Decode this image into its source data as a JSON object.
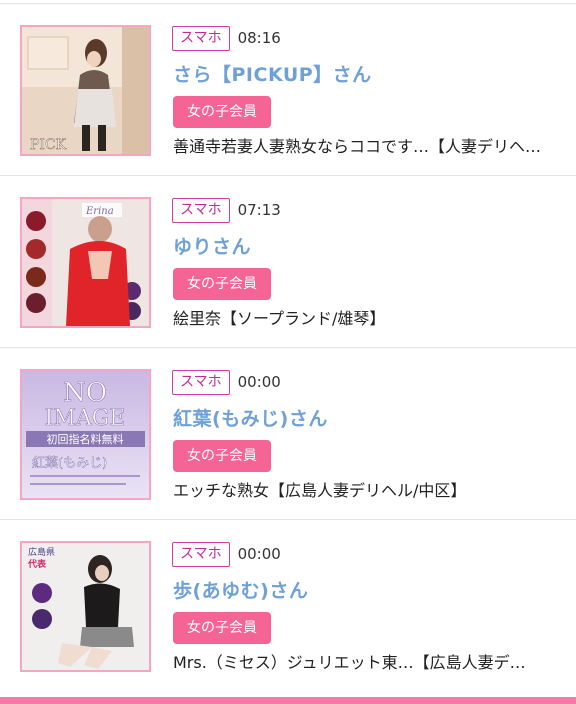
{
  "entries": [
    {
      "device": "スマホ",
      "time": "08:16",
      "name": "さら【PICKUP】さん",
      "member": "女の子会員",
      "shop": "善通寺若妻人妻熟女ならココです…【人妻デリヘ…",
      "thumb_text": "PICK"
    },
    {
      "device": "スマホ",
      "time": "07:13",
      "name": "ゆりさん",
      "member": "女の子会員",
      "shop": "絵里奈【ソープランド/雄琴】",
      "thumb_text": "Erina"
    },
    {
      "device": "スマホ",
      "time": "00:00",
      "name": "紅葉(もみじ)さん",
      "member": "女の子会員",
      "shop": "エッチな熟女【広島人妻デリヘル/中区】",
      "thumb_text": [
        "NO",
        "IMAGE",
        "初回指名料無料",
        "紅葉(もみじ)"
      ]
    },
    {
      "device": "スマホ",
      "time": "00:00",
      "name": "歩(あゆむ)さん",
      "member": "女の子会員",
      "shop": "Mrs.（ミセス）ジュリエット東…【広島人妻デ…",
      "thumb_text": [
        "広島県",
        "代表"
      ]
    }
  ]
}
